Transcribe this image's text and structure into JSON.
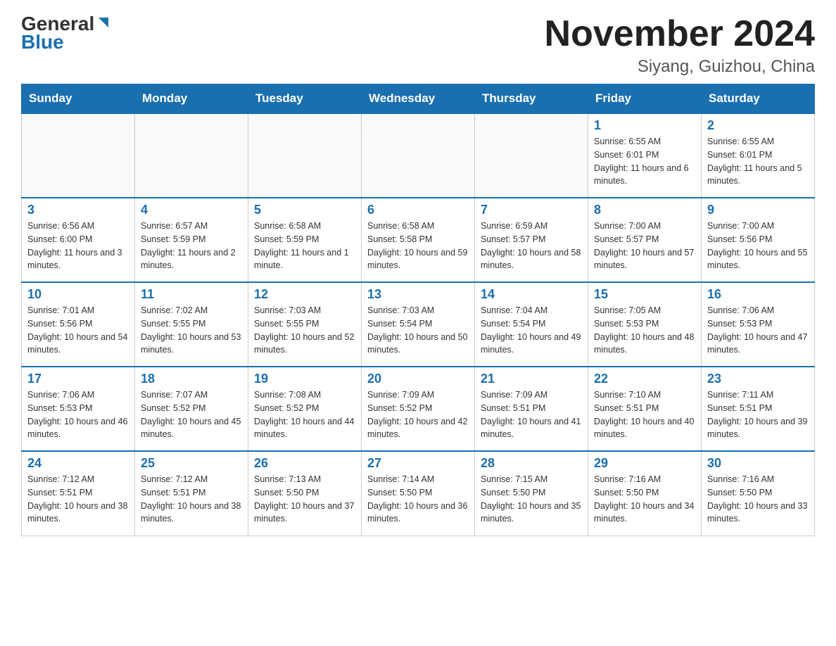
{
  "header": {
    "logo_general": "General",
    "logo_blue": "Blue",
    "title": "November 2024",
    "subtitle": "Siyang, Guizhou, China"
  },
  "days_of_week": [
    "Sunday",
    "Monday",
    "Tuesday",
    "Wednesday",
    "Thursday",
    "Friday",
    "Saturday"
  ],
  "weeks": [
    {
      "days": [
        {
          "number": "",
          "info": ""
        },
        {
          "number": "",
          "info": ""
        },
        {
          "number": "",
          "info": ""
        },
        {
          "number": "",
          "info": ""
        },
        {
          "number": "",
          "info": ""
        },
        {
          "number": "1",
          "info": "Sunrise: 6:55 AM\nSunset: 6:01 PM\nDaylight: 11 hours and 6 minutes."
        },
        {
          "number": "2",
          "info": "Sunrise: 6:55 AM\nSunset: 6:01 PM\nDaylight: 11 hours and 5 minutes."
        }
      ]
    },
    {
      "days": [
        {
          "number": "3",
          "info": "Sunrise: 6:56 AM\nSunset: 6:00 PM\nDaylight: 11 hours and 3 minutes."
        },
        {
          "number": "4",
          "info": "Sunrise: 6:57 AM\nSunset: 5:59 PM\nDaylight: 11 hours and 2 minutes."
        },
        {
          "number": "5",
          "info": "Sunrise: 6:58 AM\nSunset: 5:59 PM\nDaylight: 11 hours and 1 minute."
        },
        {
          "number": "6",
          "info": "Sunrise: 6:58 AM\nSunset: 5:58 PM\nDaylight: 10 hours and 59 minutes."
        },
        {
          "number": "7",
          "info": "Sunrise: 6:59 AM\nSunset: 5:57 PM\nDaylight: 10 hours and 58 minutes."
        },
        {
          "number": "8",
          "info": "Sunrise: 7:00 AM\nSunset: 5:57 PM\nDaylight: 10 hours and 57 minutes."
        },
        {
          "number": "9",
          "info": "Sunrise: 7:00 AM\nSunset: 5:56 PM\nDaylight: 10 hours and 55 minutes."
        }
      ]
    },
    {
      "days": [
        {
          "number": "10",
          "info": "Sunrise: 7:01 AM\nSunset: 5:56 PM\nDaylight: 10 hours and 54 minutes."
        },
        {
          "number": "11",
          "info": "Sunrise: 7:02 AM\nSunset: 5:55 PM\nDaylight: 10 hours and 53 minutes."
        },
        {
          "number": "12",
          "info": "Sunrise: 7:03 AM\nSunset: 5:55 PM\nDaylight: 10 hours and 52 minutes."
        },
        {
          "number": "13",
          "info": "Sunrise: 7:03 AM\nSunset: 5:54 PM\nDaylight: 10 hours and 50 minutes."
        },
        {
          "number": "14",
          "info": "Sunrise: 7:04 AM\nSunset: 5:54 PM\nDaylight: 10 hours and 49 minutes."
        },
        {
          "number": "15",
          "info": "Sunrise: 7:05 AM\nSunset: 5:53 PM\nDaylight: 10 hours and 48 minutes."
        },
        {
          "number": "16",
          "info": "Sunrise: 7:06 AM\nSunset: 5:53 PM\nDaylight: 10 hours and 47 minutes."
        }
      ]
    },
    {
      "days": [
        {
          "number": "17",
          "info": "Sunrise: 7:06 AM\nSunset: 5:53 PM\nDaylight: 10 hours and 46 minutes."
        },
        {
          "number": "18",
          "info": "Sunrise: 7:07 AM\nSunset: 5:52 PM\nDaylight: 10 hours and 45 minutes."
        },
        {
          "number": "19",
          "info": "Sunrise: 7:08 AM\nSunset: 5:52 PM\nDaylight: 10 hours and 44 minutes."
        },
        {
          "number": "20",
          "info": "Sunrise: 7:09 AM\nSunset: 5:52 PM\nDaylight: 10 hours and 42 minutes."
        },
        {
          "number": "21",
          "info": "Sunrise: 7:09 AM\nSunset: 5:51 PM\nDaylight: 10 hours and 41 minutes."
        },
        {
          "number": "22",
          "info": "Sunrise: 7:10 AM\nSunset: 5:51 PM\nDaylight: 10 hours and 40 minutes."
        },
        {
          "number": "23",
          "info": "Sunrise: 7:11 AM\nSunset: 5:51 PM\nDaylight: 10 hours and 39 minutes."
        }
      ]
    },
    {
      "days": [
        {
          "number": "24",
          "info": "Sunrise: 7:12 AM\nSunset: 5:51 PM\nDaylight: 10 hours and 38 minutes."
        },
        {
          "number": "25",
          "info": "Sunrise: 7:12 AM\nSunset: 5:51 PM\nDaylight: 10 hours and 38 minutes."
        },
        {
          "number": "26",
          "info": "Sunrise: 7:13 AM\nSunset: 5:50 PM\nDaylight: 10 hours and 37 minutes."
        },
        {
          "number": "27",
          "info": "Sunrise: 7:14 AM\nSunset: 5:50 PM\nDaylight: 10 hours and 36 minutes."
        },
        {
          "number": "28",
          "info": "Sunrise: 7:15 AM\nSunset: 5:50 PM\nDaylight: 10 hours and 35 minutes."
        },
        {
          "number": "29",
          "info": "Sunrise: 7:16 AM\nSunset: 5:50 PM\nDaylight: 10 hours and 34 minutes."
        },
        {
          "number": "30",
          "info": "Sunrise: 7:16 AM\nSunset: 5:50 PM\nDaylight: 10 hours and 33 minutes."
        }
      ]
    }
  ]
}
